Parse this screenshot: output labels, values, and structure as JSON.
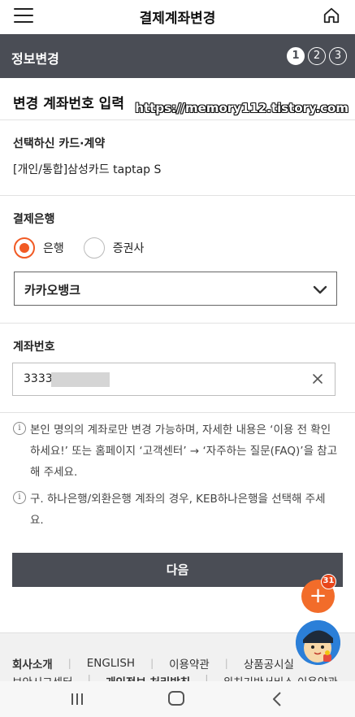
{
  "header": {
    "title": "결제계좌변경",
    "menu_icon": "hamburger-menu-icon",
    "home_icon": "home-icon"
  },
  "step_bar": {
    "label": "정보변경",
    "steps": [
      "1",
      "2",
      "3"
    ],
    "active_step": 1
  },
  "section": {
    "title": "변경 계좌번호 입력",
    "watermark": "https://memory112.tistory.com"
  },
  "card": {
    "label": "선택하신 카드·계약",
    "value": "[개인/통합]삼성카드 taptap S"
  },
  "payment_bank": {
    "label": "결제은행",
    "options": [
      "은행",
      "증권사"
    ],
    "selected": "은행",
    "select_value": "카카오뱅크"
  },
  "account": {
    "label": "계좌번호",
    "value": "3333"
  },
  "notes": [
    "본인 명의의 계좌로만 변경 가능하며, 자세한 내용은 ‘이용 전 확인하세요!’ 또는 홈페이지 ‘고객센터’ → ‘자주하는 질문(FAQ)’을 참고해 주세요.",
    "구. 하나은행/외환은행 계좌의 경우, KEB하나은행을 선택해 주세요."
  ],
  "next_button": "다음",
  "fab": {
    "badge": "31",
    "label": "+"
  },
  "footer": {
    "row1": [
      "회사소개",
      "ENGLISH",
      "이용약관",
      "상품공시실"
    ],
    "row2": [
      "보안시그센터",
      "개인정보 처리방침",
      "위치기반서비스 이용약관"
    ]
  },
  "colors": {
    "accent": "#f15a24",
    "dark_bar": "#4a4d55",
    "fab": "#f26c2a"
  }
}
